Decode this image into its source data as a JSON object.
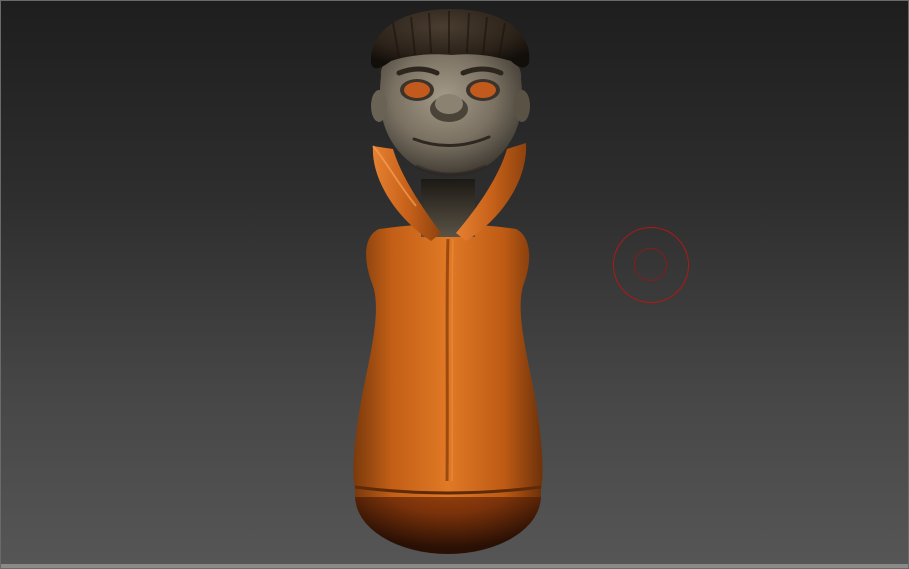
{
  "viewport": {
    "background_top": "#1e1e1e",
    "background_bottom": "#565656"
  },
  "model": {
    "name": "character-sculpt",
    "skin_color": "#7d7466",
    "hair_color": "#2a2118",
    "clothing_color": "#d46a1c",
    "eye_color": "#c25a1e"
  },
  "brush": {
    "icon": "brush-cursor-icon",
    "color": "#b01818"
  }
}
